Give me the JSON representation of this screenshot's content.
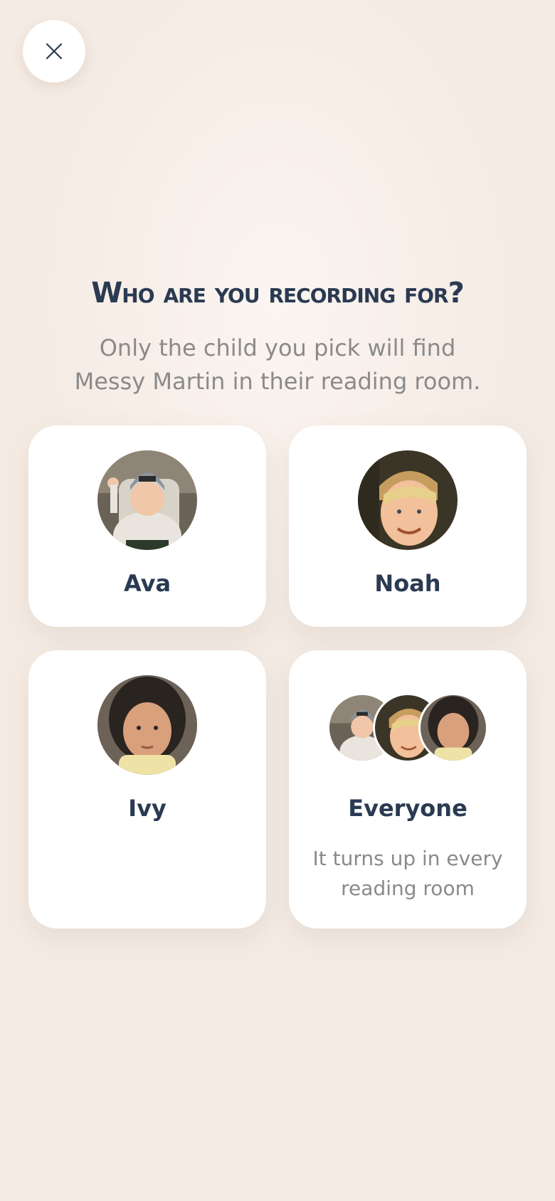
{
  "close": {
    "icon": "close-icon"
  },
  "header": {
    "title": "Who are you recording for?",
    "subtitle": "Only the child you pick will find Messy Martin in their reading room."
  },
  "children": [
    {
      "name": "Ava",
      "avatar": "child-photo-ava"
    },
    {
      "name": "Noah",
      "avatar": "child-photo-noah"
    },
    {
      "name": "Ivy",
      "avatar": "child-photo-ivy"
    }
  ],
  "everyone": {
    "name": "Everyone",
    "description": "It turns up in every reading room"
  },
  "colors": {
    "title": "#2a3a52",
    "subtitle": "#8a8a8a",
    "background": "#f7eee8",
    "card": "#ffffff"
  }
}
